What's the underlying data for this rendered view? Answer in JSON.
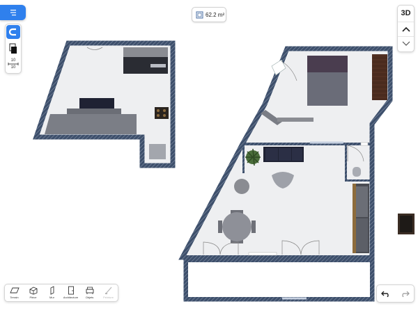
{
  "colors": {
    "accent": "#2f80ed",
    "wall": "#3d4f6b",
    "floor": "#eeeff1",
    "furniture_dark": "#1f2233"
  },
  "area": {
    "icon": "area-icon",
    "value": "62.2 m²"
  },
  "left_toolbar": {
    "magnet_icon": "magnet-icon",
    "layers_icon": "layers-icon",
    "dimensions": {
      "top": "10",
      "bottom": "10"
    }
  },
  "view_toolbar": {
    "mode_3d": "3D",
    "level_up_icon": "chevron-up-icon",
    "level_down_icon": "chevron-down-icon"
  },
  "bottom_toolbar": {
    "tools": [
      {
        "label": "Terrain",
        "icon": "terrain-icon",
        "enabled": true
      },
      {
        "label": "Pièce",
        "icon": "room-icon",
        "enabled": true
      },
      {
        "label": "Mur",
        "icon": "wall-icon",
        "enabled": true
      },
      {
        "label": "Architecture",
        "icon": "door-icon",
        "enabled": true
      },
      {
        "label": "Objets",
        "icon": "sofa-icon",
        "enabled": true
      },
      {
        "label": "Peinture",
        "icon": "paint-icon",
        "enabled": false
      }
    ]
  },
  "history": {
    "undo_icon": "undo-icon",
    "redo_icon": "redo-icon"
  }
}
